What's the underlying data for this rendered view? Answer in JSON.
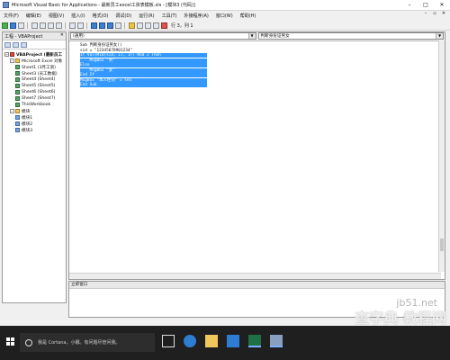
{
  "window": {
    "title": "Microsoft Visual Basic for Applications - 最新员工excel工资表模板.xls - [模块3 (代码)]"
  },
  "menu": {
    "items": [
      "文件(F)",
      "编辑(E)",
      "视图(V)",
      "插入(I)",
      "格式(O)",
      "调试(D)",
      "运行(R)",
      "工具(T)",
      "外接程序(A)",
      "窗口(W)",
      "帮助(H)"
    ]
  },
  "toolbar": {
    "cursor_position": "行 3，列 1"
  },
  "project_explorer": {
    "title": "工程 - VBAProject",
    "tree": [
      {
        "label": "VBAProject (最新员工",
        "icon": "project",
        "expander": "-",
        "indent": 0,
        "bold": true
      },
      {
        "label": "Microsoft Excel 对象",
        "icon": "folder",
        "expander": "-",
        "indent": 1
      },
      {
        "label": "Sheet1 (3月工资)",
        "icon": "sheet",
        "indent": 2
      },
      {
        "label": "Sheet3 (员工数据)",
        "icon": "sheet",
        "indent": 2
      },
      {
        "label": "Sheet4 (Sheet4)",
        "icon": "sheet",
        "indent": 2
      },
      {
        "label": "Sheet5 (Sheet5)",
        "icon": "sheet",
        "indent": 2
      },
      {
        "label": "Sheet6 (Sheet6)",
        "icon": "sheet",
        "indent": 2
      },
      {
        "label": "Sheet7 (Sheet7)",
        "icon": "sheet",
        "indent": 2
      },
      {
        "label": "ThisWorkbook",
        "icon": "sheet",
        "indent": 2
      },
      {
        "label": "模块",
        "icon": "folder",
        "expander": "-",
        "indent": 1
      },
      {
        "label": "模块1",
        "icon": "module",
        "indent": 2
      },
      {
        "label": "模块2",
        "icon": "module",
        "indent": 2
      },
      {
        "label": "模块3",
        "icon": "module",
        "indent": 2
      }
    ]
  },
  "code_window": {
    "object_combo": "(通用)",
    "procedure_combo": "判断身份证男女",
    "lines": [
      {
        "text": "Sub 判断身份证男女()",
        "selected": false
      },
      {
        "text": "sid = \"12345678901234\"",
        "selected": false
      },
      {
        "text": "If Val(Mid(sid, 17, 1)) Mod 2 Then",
        "selected": true
      },
      {
        "text": "    MsgBox \"男\"",
        "selected": true
      },
      {
        "text": "Else",
        "selected": true
      },
      {
        "text": "    MsgBox \"女\"",
        "selected": true
      },
      {
        "text": "End If",
        "selected": true
      },
      {
        "text": "MsgBox \"本人性别\" = sex",
        "selected": true
      },
      {
        "text": "End Sub",
        "selected": true
      }
    ]
  },
  "immediate_window": {
    "title": "立即窗口"
  },
  "watermark": {
    "site": "jb51.net",
    "logo": "查字典 教程网",
    "url": "jiaocheng.chazidian.com"
  },
  "taskbar": {
    "search_placeholder": "我是 Cortana，小娜。有问题尽管问我。"
  }
}
